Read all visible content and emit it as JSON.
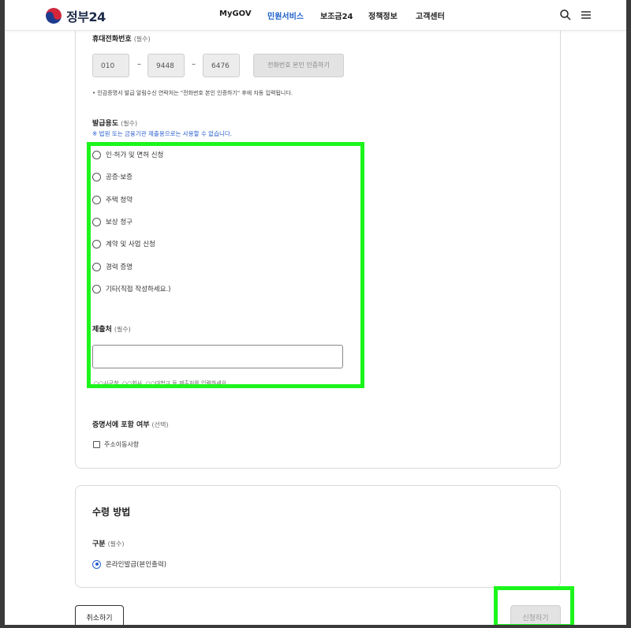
{
  "header": {
    "logo_text": "정부24",
    "nav": [
      "MyGOV",
      "민원서비스",
      "보조금24",
      "정책정보",
      "고객센터"
    ],
    "active_nav": "민원서비스",
    "accent_color": "#1a5cc8"
  },
  "phone": {
    "label": "휴대전화번호",
    "required": "(필수)",
    "part1": "010",
    "part2": "9448",
    "part3": "6476",
    "dash": "–",
    "verify_button": "전화번호 본인 인증하기",
    "note": "• 인감증명서 발급 알림수신 연락처는 \"전화번호 본인 인증하기\" 후에 자동 입력됩니다."
  },
  "purpose": {
    "label": "발급용도",
    "required": "(필수)",
    "warning": "※ 법원 또는 금융기관 제출용으로는 사용할 수 없습니다.",
    "options": [
      "인·허가 및 면허 신청",
      "공증·보증",
      "주택 청약",
      "보상 청구",
      "계약 및 사업 신청",
      "경력 증명",
      "기타(직접 작성하세요.)"
    ]
  },
  "submit_to": {
    "label": "제출처",
    "required": "(필수)",
    "value": "",
    "hint": "○○시군청, ○○회사, ○○대학교 등 제출처를 입력하세요"
  },
  "include": {
    "label": "증명서에 포함 여부",
    "optional": "(선택)",
    "checkbox_label": "주소이동사항"
  },
  "receive": {
    "title": "수령 방법",
    "label": "구분",
    "required": "(필수)",
    "option": "온라인발급(본인출력)"
  },
  "buttons": {
    "cancel": "취소하기",
    "submit": "신청하기"
  },
  "icons": {
    "search": "search-icon",
    "menu": "hamburger-menu-icon"
  },
  "highlight_color": "#1cf51c"
}
